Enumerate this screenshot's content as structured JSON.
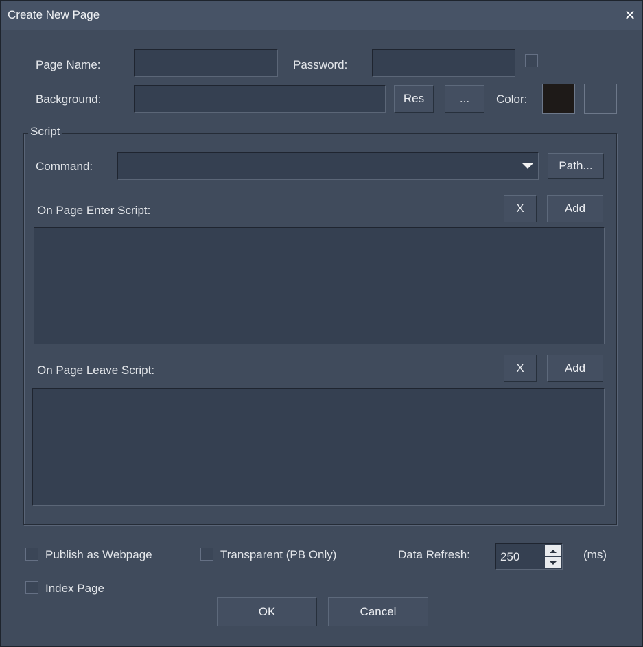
{
  "window": {
    "title": "Create New Page"
  },
  "page_name": {
    "label": "Page Name:",
    "value": ""
  },
  "password": {
    "label": "Password:",
    "value": ""
  },
  "background": {
    "label": "Background:",
    "value": "",
    "res_label": "Res",
    "browse_label": "...",
    "color_label": "Color:",
    "color_primary": "#1e1a18",
    "color_secondary": "#404b5c"
  },
  "script": {
    "group_label": "Script",
    "command_label": "Command:",
    "command_value": "",
    "path_label": "Path...",
    "enter_label": "On Page Enter Script:",
    "leave_label": "On Page Leave Script:",
    "remove_label": "X",
    "add_label": "Add"
  },
  "options": {
    "publish_label": "Publish as Webpage",
    "transparent_label": "Transparent (PB Only)",
    "index_label": "Index Page",
    "refresh_label": "Data Refresh:",
    "refresh_value": "250",
    "refresh_unit": "(ms)"
  },
  "footer": {
    "ok_label": "OK",
    "cancel_label": "Cancel"
  }
}
